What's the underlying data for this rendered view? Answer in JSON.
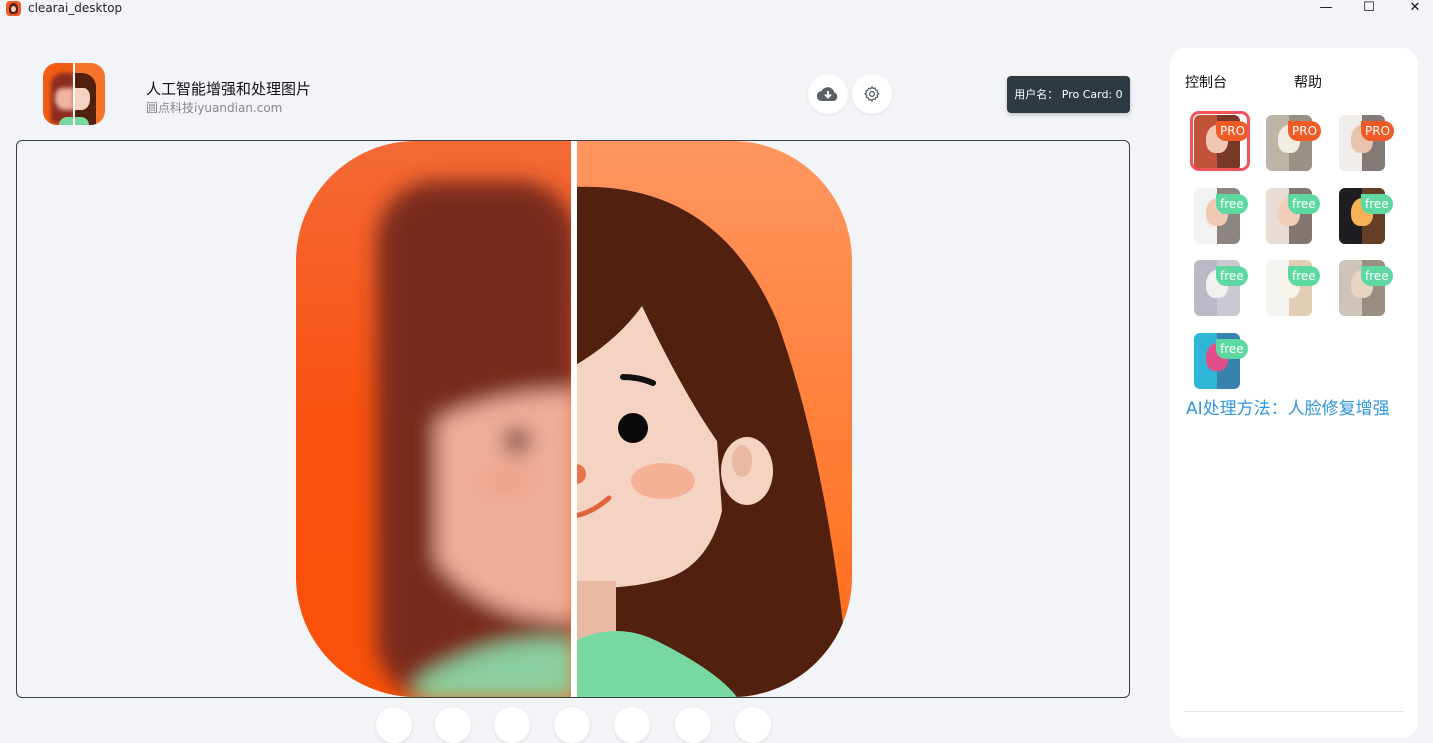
{
  "window": {
    "title": "clearai_desktop",
    "minimize": "—",
    "maximize": "☐",
    "close": "✕"
  },
  "header": {
    "title": "人工智能增强和处理图片",
    "subtitle": "圆点科技iyuandian.com",
    "user_badge": "用户名： Pro Card: 0",
    "download_icon": "cloud-download-icon",
    "settings_icon": "gear-icon"
  },
  "sidebar": {
    "tabs": [
      "控制台",
      "帮助"
    ],
    "models": [
      {
        "badge": "PRO",
        "kind": "pro",
        "selected": true,
        "colors": [
          "#c0533a",
          "#3a2218",
          "#f1c7b3"
        ]
      },
      {
        "badge": "PRO",
        "kind": "pro",
        "selected": false,
        "colors": [
          "#bdb5a6",
          "#7b7468",
          "#f1ece2"
        ]
      },
      {
        "badge": "PRO",
        "kind": "pro",
        "selected": false,
        "colors": [
          "#f0ecea",
          "#2a1c16",
          "#e8c3ad"
        ]
      },
      {
        "badge": "free",
        "kind": "free",
        "selected": false,
        "colors": [
          "#f2f2f2",
          "#3b2c27",
          "#f0c9b3"
        ]
      },
      {
        "badge": "free",
        "kind": "free",
        "selected": false,
        "colors": [
          "#e9dcd6",
          "#2f221e",
          "#f2cdb8"
        ]
      },
      {
        "badge": "free",
        "kind": "free",
        "selected": false,
        "colors": [
          "#1d1d22",
          "#a0592a",
          "#f6b255"
        ]
      },
      {
        "badge": "free",
        "kind": "free",
        "selected": false,
        "colors": [
          "#bbb8c8",
          "#d9d4dc",
          "#f2efef"
        ]
      },
      {
        "badge": "free",
        "kind": "free",
        "selected": false,
        "colors": [
          "#f4f3ef",
          "#d5ad84",
          "#f7f2ea"
        ]
      },
      {
        "badge": "free",
        "kind": "free",
        "selected": false,
        "colors": [
          "#cfc3b8",
          "#6e5e53",
          "#e7d4c2"
        ]
      },
      {
        "badge": "free",
        "kind": "free",
        "selected": false,
        "colors": [
          "#2fb6d6",
          "#3e5a8c",
          "#e34e8a"
        ]
      }
    ],
    "method_label": "AI处理方法：人脸修复增强"
  },
  "colors": {
    "accent_orange": "#f05a24",
    "free_green": "#5ed8a1",
    "selection_red": "#f2525a",
    "method_blue": "#2f95dc",
    "badge_dark": "#2f3a40"
  }
}
